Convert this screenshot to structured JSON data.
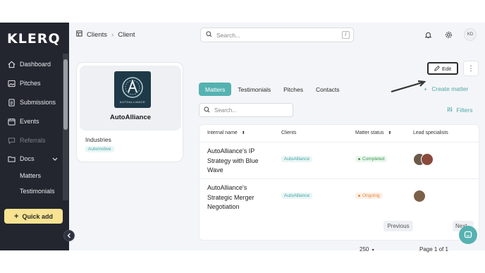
{
  "sidebar": {
    "logo": "KLERQ",
    "items": [
      {
        "label": "Dashboard",
        "icon": "home-icon"
      },
      {
        "label": "Pitches",
        "icon": "image-icon"
      },
      {
        "label": "Submissions",
        "icon": "document-icon"
      },
      {
        "label": "Events",
        "icon": "calendar-icon"
      },
      {
        "label": "Referrals",
        "icon": "chat-icon"
      },
      {
        "label": "Docs",
        "icon": "folder-icon"
      }
    ],
    "docs_sub": [
      "Matters",
      "Testimonials"
    ],
    "quick_add": "Quick add"
  },
  "topbar": {
    "breadcrumb": [
      "Clients",
      "Client"
    ],
    "search_placeholder": "Search...",
    "search_shortcut": "/",
    "user_initials": "KD"
  },
  "client": {
    "name": "AutoAlliance",
    "logo_text": "AUTOALLIANCE",
    "industries_label": "Industries",
    "industry_tag": "Automotive"
  },
  "actions": {
    "edit": "Edit",
    "more": "⋮"
  },
  "tabs": [
    "Matters",
    "Testimonials",
    "Pitches",
    "Contacts"
  ],
  "create_matter": "Create matter",
  "filters": "Filters",
  "table_search_placeholder": "Search...",
  "table": {
    "headers": [
      "Internal name",
      "Clients",
      "Matter status",
      "Lead specialists"
    ],
    "rows": [
      {
        "name": "AutoAlliance's IP Strategy with Blue Wave",
        "client": "AutoAlliance",
        "status": "Completed"
      },
      {
        "name": "AutoAlliance's Strategic Merger Negotiation",
        "client": "AutoAlliance",
        "status": "Ongoing"
      }
    ]
  },
  "pagination": {
    "per_page": "250",
    "previous": "Previous",
    "page": "Page 1 of 1",
    "next": "Next"
  },
  "colors": {
    "sidebar": "#23262f",
    "accent": "#55b2b1",
    "quick_add": "#f7e391",
    "completed": "#3d9a54",
    "ongoing": "#e38a3d"
  }
}
